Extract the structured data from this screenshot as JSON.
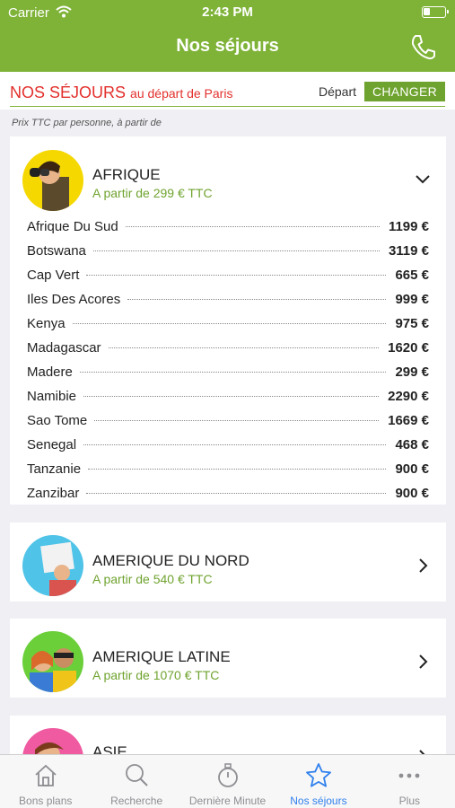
{
  "status": {
    "carrier": "Carrier",
    "time": "2:43 PM"
  },
  "nav": {
    "title": "Nos séjours",
    "phone_icon": "phone-icon"
  },
  "depart": {
    "title": "NOS SÉJOURS",
    "subtitle": "au départ de Paris",
    "label": "Départ",
    "button": "CHANGER"
  },
  "note": "Prix TTC par personne, à partir de",
  "regions": [
    {
      "name": "AFRIQUE",
      "from": "A partir de 299 € TTC",
      "expanded": true,
      "destinations": [
        {
          "name": "Afrique Du Sud",
          "price": "1199 €"
        },
        {
          "name": "Botswana",
          "price": "3119 €"
        },
        {
          "name": "Cap Vert",
          "price": "665 €"
        },
        {
          "name": "Iles Des Acores",
          "price": "999 €"
        },
        {
          "name": "Kenya",
          "price": "975 €"
        },
        {
          "name": "Madagascar",
          "price": "1620 €"
        },
        {
          "name": "Madere",
          "price": "299 €"
        },
        {
          "name": "Namibie",
          "price": "2290 €"
        },
        {
          "name": "Sao Tome",
          "price": "1669 €"
        },
        {
          "name": "Senegal",
          "price": "468 €"
        },
        {
          "name": "Tanzanie",
          "price": "900 €"
        },
        {
          "name": "Zanzibar",
          "price": "900 €"
        }
      ]
    },
    {
      "name": "AMERIQUE DU NORD",
      "from": "A partir de 540 € TTC",
      "expanded": false
    },
    {
      "name": "AMERIQUE LATINE",
      "from": "A partir de 1070 € TTC",
      "expanded": false
    },
    {
      "name": "ASIE",
      "from": "",
      "expanded": false
    }
  ],
  "tabs": [
    {
      "label": "Bons plans",
      "icon": "house-icon",
      "active": false
    },
    {
      "label": "Recherche",
      "icon": "search-icon",
      "active": false
    },
    {
      "label": "Dernière Minute",
      "icon": "stopwatch-icon",
      "active": false
    },
    {
      "label": "Nos séjours",
      "icon": "star-icon",
      "active": true
    },
    {
      "label": "Plus",
      "icon": "more-icon",
      "active": false
    }
  ],
  "colors": {
    "brand_green": "#7fb338",
    "accent_red": "#e2302c",
    "tab_active": "#2f80ed"
  }
}
